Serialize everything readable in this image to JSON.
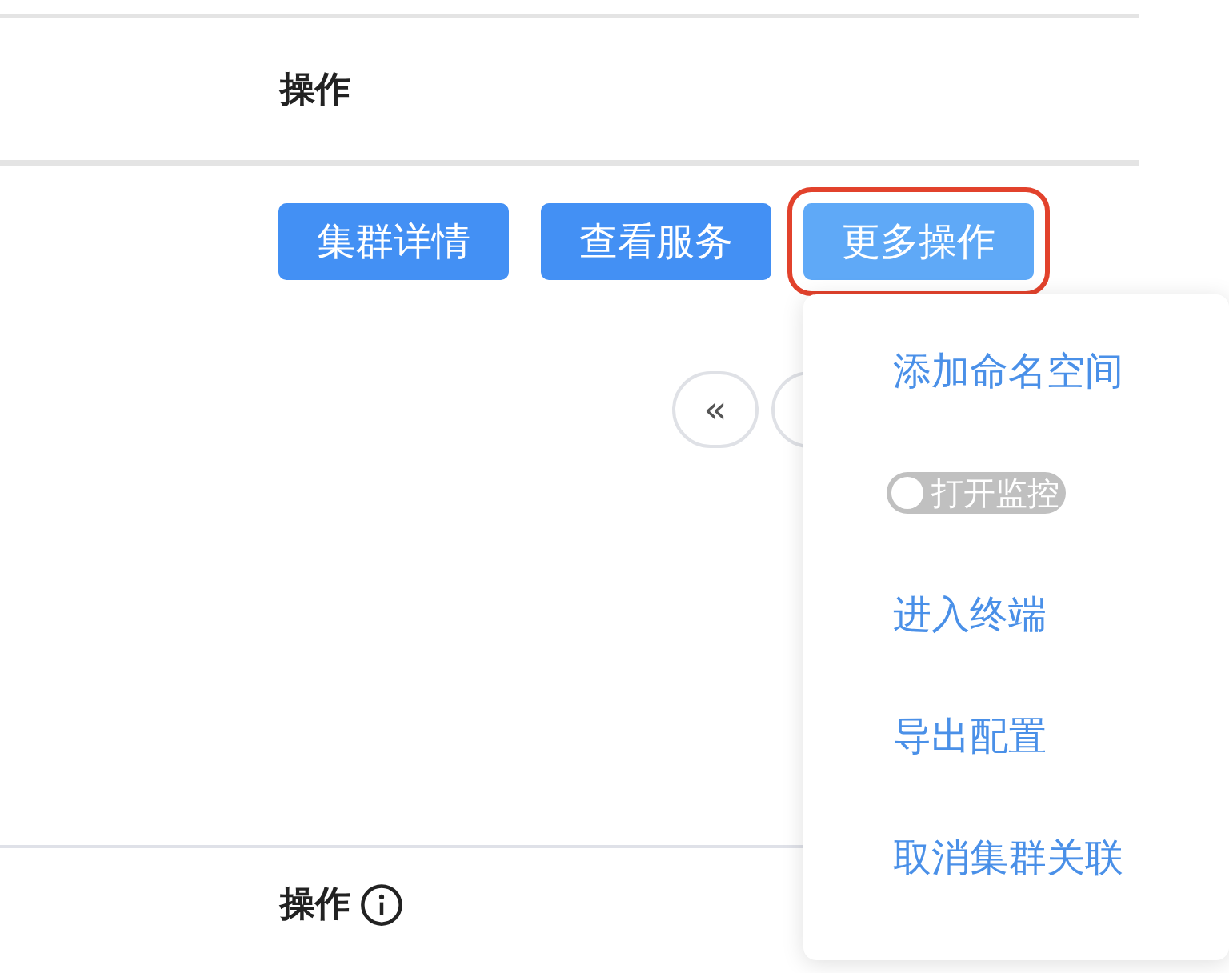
{
  "table_top": {
    "column_header": "操作"
  },
  "row_actions": [
    {
      "label": "集群详情",
      "highlighted": false
    },
    {
      "label": "查看服务",
      "highlighted": false
    },
    {
      "label": "更多操作",
      "highlighted": true
    }
  ],
  "pagination": {
    "first": "«"
  },
  "dropdown_menu": {
    "items": [
      {
        "kind": "link",
        "label": "添加命名空间"
      },
      {
        "kind": "toggle",
        "label": "打开监控",
        "on": false
      },
      {
        "kind": "link",
        "label": "进入终端"
      },
      {
        "kind": "link",
        "label": "导出配置"
      },
      {
        "kind": "link",
        "label": "取消集群关联"
      }
    ]
  },
  "table_bottom": {
    "column_header": "操作",
    "info": true
  }
}
